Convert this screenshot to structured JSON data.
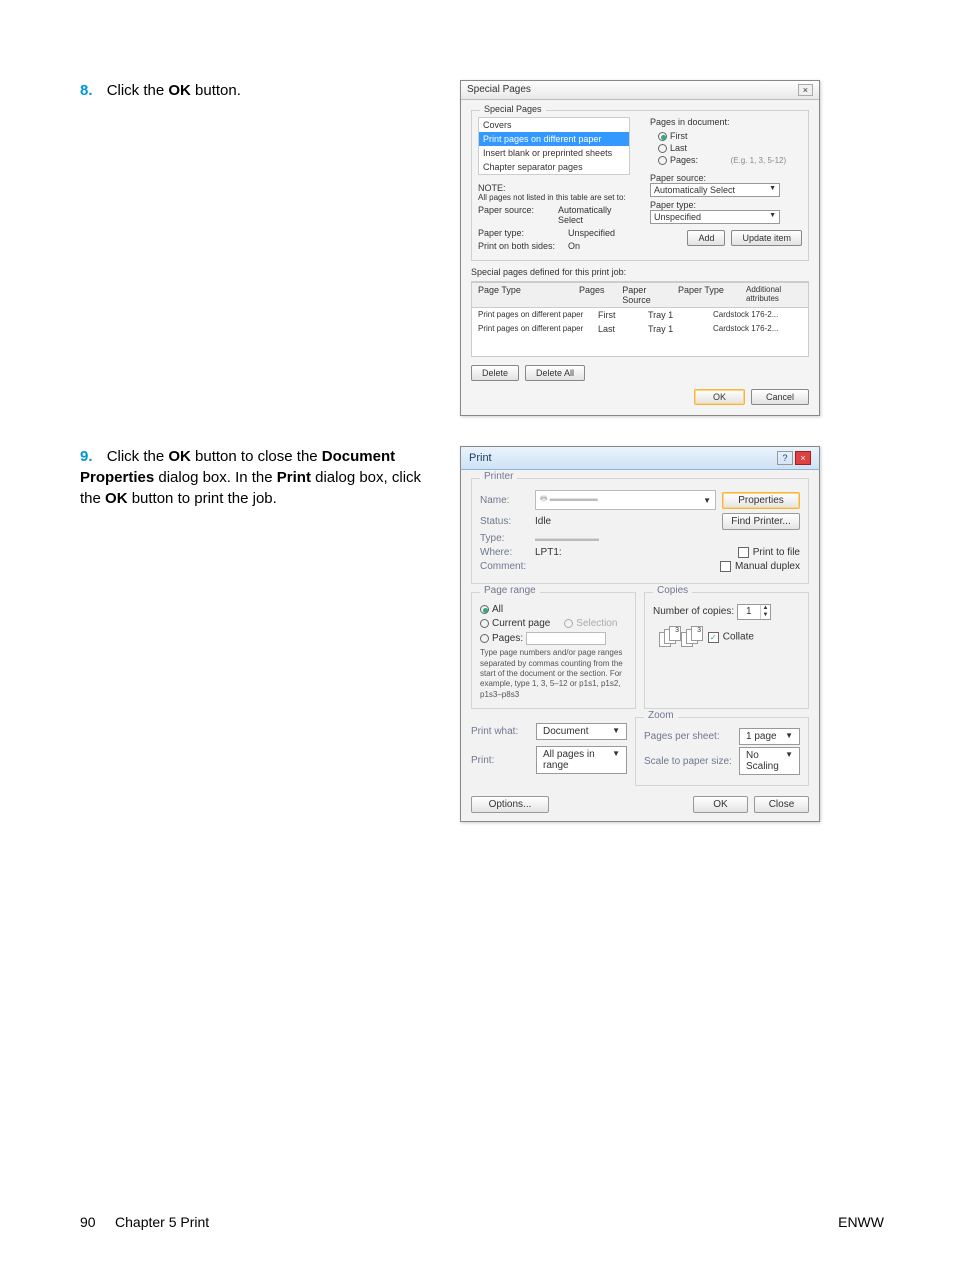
{
  "step8": {
    "num": "8.",
    "text_prefix": "Click the ",
    "text_bold": "OK",
    "text_suffix": " button."
  },
  "step9": {
    "num": "9.",
    "parts": [
      "Click the ",
      "OK",
      " button to close the ",
      "Document Properties",
      " dialog box. In the ",
      "Print",
      " dialog box, click the ",
      "OK",
      " button to print the job."
    ]
  },
  "dlg1": {
    "title": "Special Pages",
    "group1_title": "Special Pages",
    "items": [
      "Covers",
      "Print pages on different paper",
      "Insert blank or preprinted sheets",
      "Chapter separator pages"
    ],
    "pages_in_doc": "Pages in document:",
    "first": "First",
    "last": "Last",
    "pages": "Pages:",
    "pages_eg": "(E.g. 1, 3, 5-12)",
    "note_title": "NOTE:",
    "note_text": "All pages not listed in this table are set to:",
    "paper_source": "Paper source:",
    "paper_source_val": "Automatically Select",
    "paper_type": "Paper type:",
    "paper_type_val": "Unspecified",
    "print_both": "Print on both sides:",
    "print_both_val": "On",
    "right_ps": "Paper source:",
    "right_ps_val": "Automatically Select",
    "right_pt": "Paper type:",
    "right_pt_val": "Unspecified",
    "add_btn": "Add",
    "update_btn": "Update item",
    "defined_title": "Special pages defined for this print job:",
    "headers": [
      "Page Type",
      "Pages",
      "Paper Source",
      "Paper Type",
      "Additional attributes"
    ],
    "rows": [
      [
        "Print pages on different paper",
        "First",
        "Tray 1",
        "Cardstock 176-2...",
        ""
      ],
      [
        "Print pages on different paper",
        "Last",
        "Tray 1",
        "Cardstock 176-2...",
        ""
      ]
    ],
    "delete_btn": "Delete",
    "delete_all_btn": "Delete All",
    "ok_btn": "OK",
    "cancel_btn": "Cancel"
  },
  "dlg2": {
    "title": "Print",
    "printer_section": "Printer",
    "name_lbl": "Name:",
    "status_lbl": "Status:",
    "status_val": "Idle",
    "type_lbl": "Type:",
    "where_lbl": "Where:",
    "where_val": "LPT1:",
    "comment_lbl": "Comment:",
    "properties_btn": "Properties",
    "find_printer_btn": "Find Printer...",
    "print_to_file": "Print to file",
    "manual_duplex": "Manual duplex",
    "page_range_section": "Page range",
    "all": "All",
    "current_page": "Current page",
    "selection": "Selection",
    "pages_lbl": "Pages:",
    "pages_hint": "Type page numbers and/or page ranges separated by commas counting from the start of the document or the section. For example, type 1, 3, 5–12 or p1s1, p1s2, p1s3–p8s3",
    "copies_section": "Copies",
    "num_copies": "Number of copies:",
    "num_copies_val": "1",
    "collate": "Collate",
    "print_what_lbl": "Print what:",
    "print_what_val": "Document",
    "print_lbl": "Print:",
    "print_val": "All pages in range",
    "zoom_section": "Zoom",
    "pps_lbl": "Pages per sheet:",
    "pps_val": "1 page",
    "sps_lbl": "Scale to paper size:",
    "sps_val": "No Scaling",
    "options_btn": "Options...",
    "ok_btn": "OK",
    "close_btn": "Close"
  },
  "footer": {
    "page": "90",
    "chapter": "Chapter 5   Print",
    "brand": "ENWW"
  }
}
